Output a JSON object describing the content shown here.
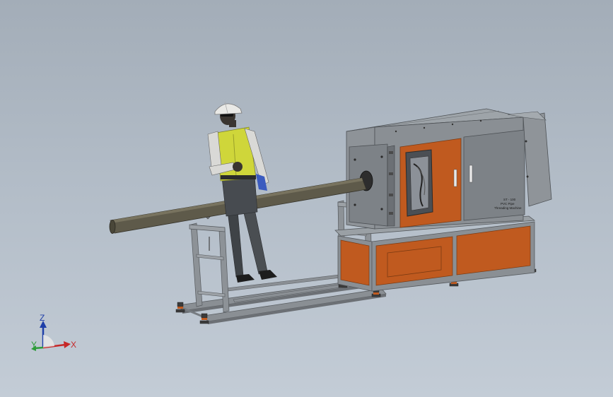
{
  "viewport": {
    "name": "graphics-area",
    "background_top": "#a3adb8",
    "background_bottom": "#c3ccd6"
  },
  "machine": {
    "nameplate_line1": "ST - 100",
    "nameplate_line2": "PVC Pipe",
    "nameplate_line3": "Threading Machine",
    "frame_color": "#7f8489",
    "panel_color": "#c05a1f",
    "pipe_color": "#5e5a4a"
  },
  "operator": {
    "vest_color": "#cfd63a",
    "helmet_color": "#e9e9e6"
  },
  "triad": {
    "x_label": "X",
    "y_label": "Y",
    "z_label": "Z",
    "x_color": "#c62828",
    "y_color": "#2e9c3a",
    "z_color": "#1f3fa8"
  }
}
